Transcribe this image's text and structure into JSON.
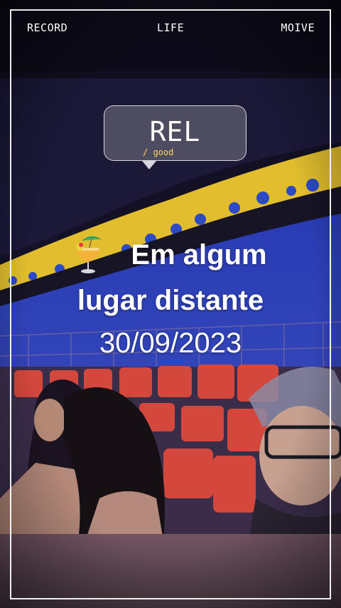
{
  "header": {
    "left_label": "RECORD",
    "center_label": "LIFE",
    "right_label": "MOIVE"
  },
  "bubble": {
    "title": "REL",
    "subtitle": "/ good"
  },
  "caption": {
    "line1": "Em algum",
    "line2": "lugar distante",
    "date": "30/09/2023",
    "icon": "tropical-drink-icon"
  },
  "colors": {
    "text": "#ffffff",
    "subtitle": "#ffd85a",
    "flag_yellow": "#e8c431",
    "flag_blue": "#2236a0",
    "chair_red": "#d6453a"
  }
}
